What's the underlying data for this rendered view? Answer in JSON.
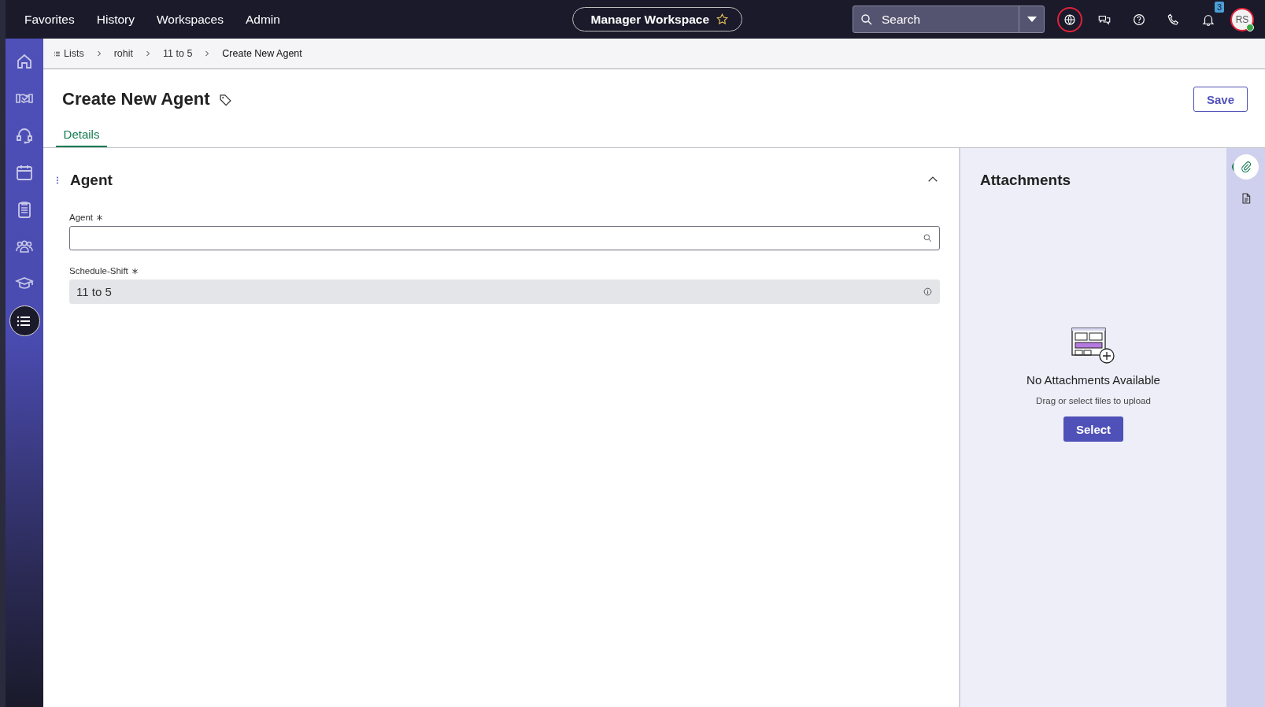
{
  "top_nav": {
    "menu": [
      {
        "label": "Favorites"
      },
      {
        "label": "History"
      },
      {
        "label": "Workspaces"
      },
      {
        "label": "Admin"
      }
    ],
    "workspace": {
      "label": "Manager Workspace"
    },
    "search": {
      "placeholder": "Search"
    },
    "notification_count": "3",
    "avatar": {
      "initials": "RS"
    }
  },
  "sidebar": {
    "items": [
      {
        "selected": false
      },
      {
        "selected": false
      },
      {
        "selected": false
      },
      {
        "selected": false
      },
      {
        "selected": false
      },
      {
        "selected": false
      },
      {
        "selected": false
      },
      {
        "selected": true
      }
    ]
  },
  "breadcrumb": [
    {
      "label": "Lists"
    },
    {
      "label": "rohit"
    },
    {
      "label": "11 to 5"
    },
    {
      "label": "Create New Agent"
    }
  ],
  "page": {
    "title": "Create New Agent",
    "save_button": "Save",
    "tabs": [
      {
        "label": "Details",
        "selected": true
      }
    ]
  },
  "section": {
    "title": "Agent",
    "expanded": true,
    "fields": [
      {
        "kind": "lookup",
        "label": "Agent",
        "required": true
      },
      {
        "kind": "readonly",
        "label": "Schedule-Shift",
        "required": true,
        "value": "11 to 5"
      }
    ]
  },
  "attachments": {
    "title": "Attachments",
    "empty_title": "No Attachments Available",
    "hint": "Drag or select files to upload",
    "button": "Select"
  },
  "right_rail": {
    "items": [
      {
        "selected": true
      },
      {
        "selected": false
      }
    ]
  }
}
